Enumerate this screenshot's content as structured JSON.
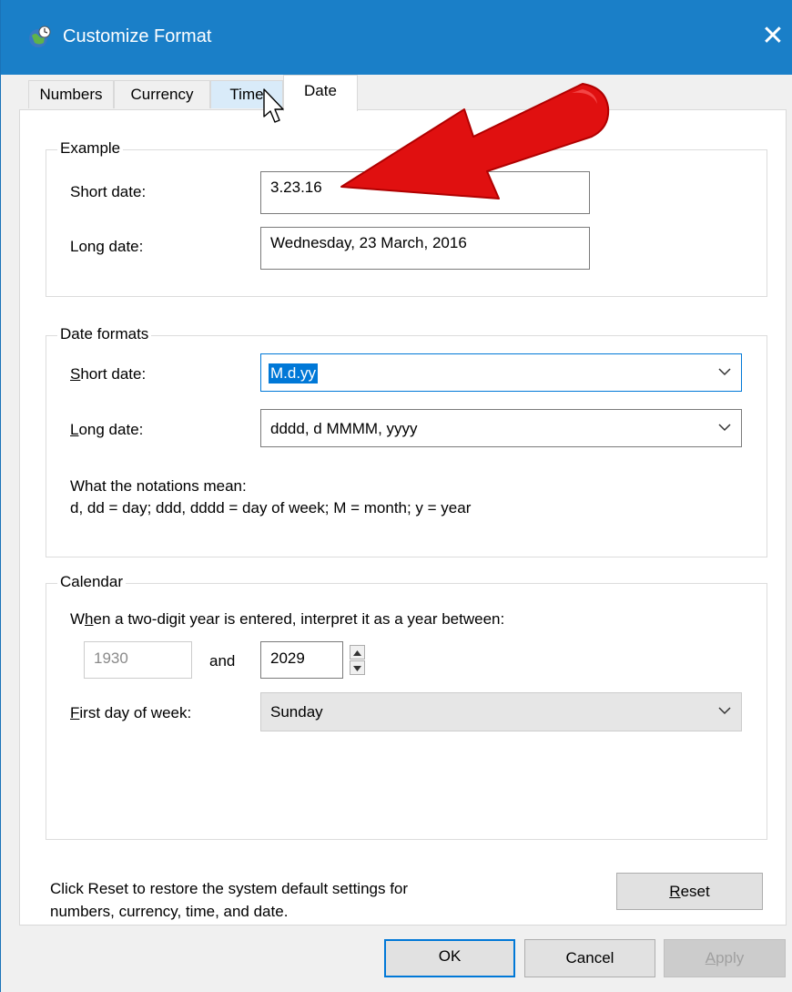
{
  "window": {
    "title": "Customize Format",
    "close_glyph": "✕"
  },
  "tabs": [
    {
      "label": "Numbers"
    },
    {
      "label": "Currency"
    },
    {
      "label": "Time"
    },
    {
      "label": "Date",
      "active": true
    }
  ],
  "example": {
    "group_label": "Example",
    "short_date_label": "Short date:",
    "short_date_value": "3.23.16",
    "long_date_label": "Long date:",
    "long_date_value": "Wednesday, 23 March, 2016"
  },
  "date_formats": {
    "group_label": "Date formats",
    "short_date_label_u": "S",
    "short_date_label_rest": "hort date:",
    "short_date_value": "M.d.yy",
    "long_date_label_u": "L",
    "long_date_label_rest": "ong date:",
    "long_date_value": "dddd, d MMMM, yyyy",
    "notations_title": "What the notations mean:",
    "notations_text": "d, dd = day;  ddd, dddd = day of week;  M = month;  y = year"
  },
  "calendar": {
    "group_label": "Calendar",
    "two_digit_pre": "W",
    "two_digit_u": "h",
    "two_digit_rest": "en a two-digit year is entered, interpret it as a year between:",
    "year_from": "1930",
    "and_label": "and",
    "year_to": "2029",
    "first_day_label_u": "F",
    "first_day_label_rest": "irst day of week:",
    "first_day_value": "Sunday"
  },
  "reset": {
    "text_line1": "Click Reset to restore the system default settings for",
    "text_line2": "numbers, currency, time, and date.",
    "button_u": "R",
    "button_rest": "eset"
  },
  "footer": {
    "ok_label": "OK",
    "cancel_label": "Cancel",
    "apply_u": "A",
    "apply_rest": "pply"
  },
  "icons": {
    "title": "globe-clock-icon",
    "dropdown": "chevron-down-icon",
    "spin_up": "spin-up-icon",
    "spin_down": "spin-down-icon",
    "cursor": "mouse-pointer-icon",
    "annotation": "red-arrow-icon"
  },
  "colors": {
    "titlebar": "#1a7fc8",
    "selection": "#0078d7",
    "annotation": "#e01010"
  }
}
